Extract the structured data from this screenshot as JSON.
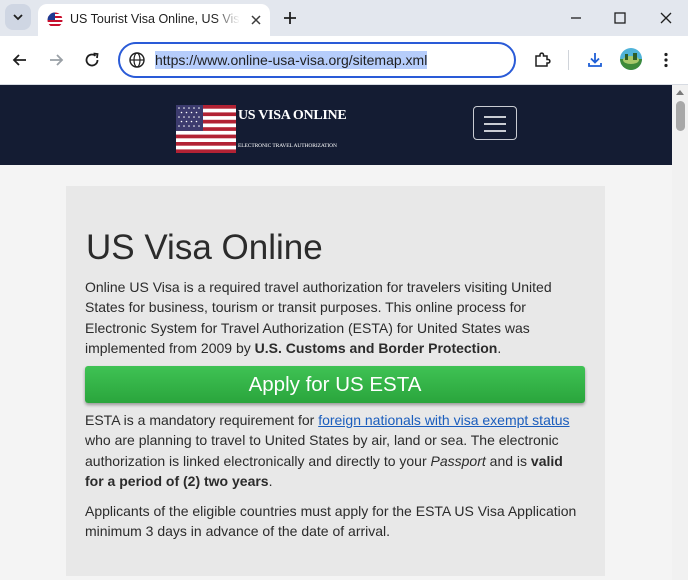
{
  "browser": {
    "tab": {
      "title": "US Tourist Visa Online, US Visa Application",
      "favicon_icon": "us-flag-icon"
    },
    "address_bar": {
      "url": "https://www.online-usa-visa.org/sitemap.xml"
    },
    "colors": {
      "accent": "#2a5bd7",
      "selection": "#b6cdfb"
    }
  },
  "site": {
    "logo": {
      "title": "US VISA ONLINE",
      "subtitle": "ELECTRONIC TRAVEL AUTHORIZATION"
    },
    "header_color": "#141c33"
  },
  "content": {
    "title": "US Visa Online",
    "intro": {
      "text": "Online US Visa is a required travel authorization for travelers visiting United States for business, tourism or transit purposes. This online process for Electronic System for Travel Authorization (ESTA) for United States was implemented from 2009 by ",
      "bold": "U.S. Customs and Border Protection",
      "end": "."
    },
    "apply_button": {
      "label": "Apply for US ESTA",
      "color": "#34b449"
    },
    "esta": {
      "t1": "ESTA is a mandatory requirement for ",
      "link": "foreign nationals with visa exempt status",
      "t2": " who are planning to travel to United States by air, land or sea. The electronic authorization is linked electronically and directly to your ",
      "italic": "Passport",
      "t3": " and is ",
      "bold": "valid for a period of (2) two years",
      "t4": "."
    },
    "applicants": {
      "text": "Applicants of the eligible countries must apply for the ESTA US Visa Application minimum 3 days in advance of the date of arrival."
    }
  }
}
